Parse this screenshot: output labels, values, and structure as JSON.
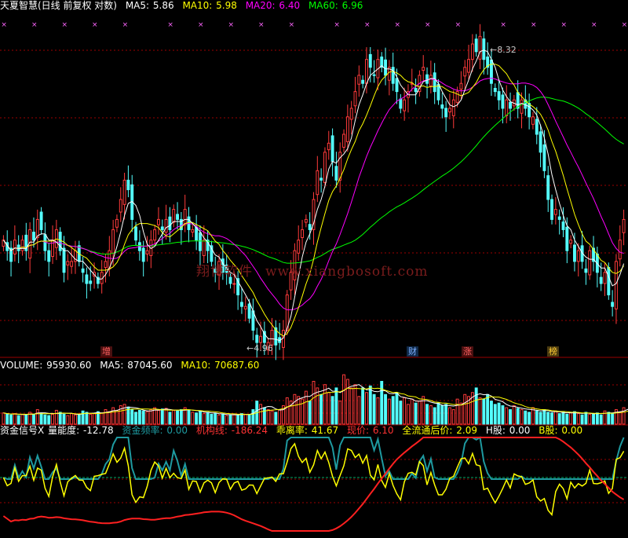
{
  "header": {
    "title": "天夏智慧(日线 前复权 对数)",
    "ma": [
      {
        "label": "MA5:",
        "value": "5.86",
        "color": "#ffffff"
      },
      {
        "label": "MA10:",
        "value": "5.98",
        "color": "#ffff00"
      },
      {
        "label": "MA20:",
        "value": "6.40",
        "color": "#ff00ff"
      },
      {
        "label": "MA60:",
        "value": "6.96",
        "color": "#00ff00"
      }
    ]
  },
  "volume_header": {
    "title": "VOLUME:",
    "value": "95930.60",
    "ma": [
      {
        "label": "MA5:",
        "value": "87045.60",
        "color": "#ffffff"
      },
      {
        "label": "MA10:",
        "value": "70687.60",
        "color": "#ffff00"
      }
    ]
  },
  "indicator_header": {
    "title": "资金信号X",
    "items": [
      {
        "label": "量能度:",
        "value": "-12.78",
        "color": "#ffffff"
      },
      {
        "label": "资金频率:",
        "value": "0.00",
        "color": "#1e9aa0"
      },
      {
        "label": "机构线:",
        "value": "-186.24",
        "color": "#ff3333"
      },
      {
        "label": "乖离率:",
        "value": "41.67",
        "color": "#ffff00"
      },
      {
        "label": "现价:",
        "value": "6.10",
        "color": "#ff3333"
      },
      {
        "label": "全流通后价:",
        "value": "2.09",
        "color": "#ffff00"
      },
      {
        "label": "H股:",
        "value": "0.00",
        "color": "#ffffff"
      },
      {
        "label": "B股:",
        "value": "0.00",
        "color": "#ffff00"
      }
    ]
  },
  "watermark": {
    "name": "翔博软件",
    "url": "www.xiangbosoft.com"
  },
  "annotations": {
    "high": "8.32",
    "low": "4.96"
  },
  "markers": [
    {
      "label": "增",
      "bg": "#4a1010",
      "color": "#ff6060"
    },
    {
      "label": "财",
      "bg": "#102a4a",
      "color": "#7fb0ff"
    },
    {
      "label": "涨",
      "bg": "#4a1010",
      "color": "#ff6060"
    },
    {
      "label": "榜",
      "bg": "#4a3a10",
      "color": "#ffcc33"
    }
  ],
  "colors": {
    "up": "#ff3b3b",
    "down": "#54ffff",
    "ma5": "#ffffff",
    "ma10": "#ffff00",
    "ma20": "#ff00ff",
    "ma60": "#00ff00",
    "grid": "#9b0000",
    "signal": "#ff66ff"
  },
  "chart_data": {
    "type": "candlestick",
    "series_name": "天夏智慧(日线 前复权 对数)",
    "y_scale": "log",
    "ylim": [
      4.9,
      8.5
    ],
    "annotated_high": 8.32,
    "annotated_low": 4.96,
    "close": [
      5.9,
      5.8,
      5.7,
      5.9,
      5.8,
      5.9,
      5.8,
      6.0,
      5.9,
      6.1,
      6.0,
      5.8,
      5.7,
      5.9,
      6.0,
      5.8,
      5.6,
      5.7,
      5.7,
      5.8,
      5.7,
      5.6,
      5.5,
      5.5,
      5.6,
      5.5,
      5.6,
      5.7,
      5.8,
      6.0,
      6.1,
      6.3,
      6.5,
      6.4,
      6.1,
      5.9,
      5.8,
      5.7,
      5.8,
      5.9,
      6.0,
      6.1,
      6.0,
      6.1,
      6.0,
      6.2,
      6.1,
      6.0,
      6.2,
      6.0,
      6.0,
      5.9,
      5.8,
      5.9,
      5.8,
      5.7,
      5.6,
      5.7,
      5.6,
      5.6,
      5.5,
      5.5,
      5.4,
      5.3,
      5.3,
      5.2,
      5.1,
      5.0,
      5.05,
      5.0,
      5.0,
      5.1,
      4.98,
      5.0,
      5.1,
      5.4,
      5.6,
      5.8,
      5.9,
      6.0,
      6.1,
      6.0,
      6.3,
      6.6,
      6.5,
      6.8,
      6.9,
      6.7,
      6.5,
      6.8,
      7.0,
      7.2,
      7.3,
      7.5,
      7.7,
      7.6,
      7.9,
      7.8,
      7.7,
      7.9,
      7.8,
      7.7,
      7.8,
      7.6,
      7.5,
      7.3,
      7.4,
      7.5,
      7.6,
      7.5,
      7.7,
      7.8,
      7.6,
      7.7,
      7.5,
      7.4,
      7.3,
      7.2,
      7.3,
      7.4,
      7.5,
      7.6,
      7.8,
      7.9,
      8.1,
      8.0,
      8.2,
      7.9,
      7.8,
      7.6,
      7.5,
      7.4,
      7.3,
      7.4,
      7.3,
      7.4,
      7.3,
      7.4,
      7.3,
      7.2,
      7.2,
      7.0,
      6.8,
      6.6,
      6.3,
      6.1,
      6.2,
      6.1,
      6.0,
      5.8,
      5.9,
      5.7,
      5.8,
      5.7,
      5.6,
      5.8,
      5.7,
      5.6,
      5.5,
      5.6,
      5.4,
      5.3,
      5.7,
      5.9,
      6.1
    ],
    "volume": [
      17000,
      15000,
      14000,
      16000,
      13000,
      15000,
      14000,
      18000,
      15000,
      22000,
      17000,
      14000,
      13000,
      15000,
      21000,
      18000,
      15000,
      13000,
      16000,
      14000,
      15000,
      20000,
      18000,
      15000,
      16000,
      19000,
      17000,
      22000,
      19000,
      25000,
      21000,
      28000,
      30000,
      26000,
      22000,
      18000,
      21000,
      20000,
      19000,
      22000,
      25000,
      21000,
      23000,
      24000,
      18000,
      21000,
      20000,
      22000,
      25000,
      21000,
      18000,
      17000,
      20000,
      16000,
      18000,
      15000,
      16000,
      14000,
      15000,
      13000,
      14000,
      15000,
      14000,
      16000,
      15000,
      14000,
      22000,
      35000,
      30000,
      25000,
      22000,
      20000,
      18000,
      22000,
      28000,
      40000,
      35000,
      45000,
      42000,
      38000,
      50000,
      35000,
      65000,
      55000,
      45000,
      60000,
      48000,
      42000,
      55000,
      35000,
      75000,
      68000,
      55000,
      60000,
      42000,
      55000,
      48000,
      58000,
      45000,
      40000,
      65000,
      45000,
      38000,
      42000,
      48000,
      35000,
      40000,
      30000,
      38000,
      32000,
      35000,
      42000,
      30000,
      28000,
      25000,
      32000,
      28000,
      30000,
      25000,
      22000,
      38000,
      32000,
      45000,
      42000,
      48000,
      55000,
      40000,
      38000,
      45000,
      35000,
      30000,
      32000,
      28000,
      25000,
      22000,
      28000,
      24000,
      22000,
      20000,
      18000,
      25000,
      20000,
      18000,
      22000,
      18000,
      17000,
      20000,
      16000,
      18000,
      15000,
      17000,
      19000,
      16000,
      14000,
      18000,
      15000,
      16000,
      17000,
      14000,
      20000,
      18000,
      16000,
      22000,
      18000,
      25000,
      30000,
      22000
    ]
  }
}
